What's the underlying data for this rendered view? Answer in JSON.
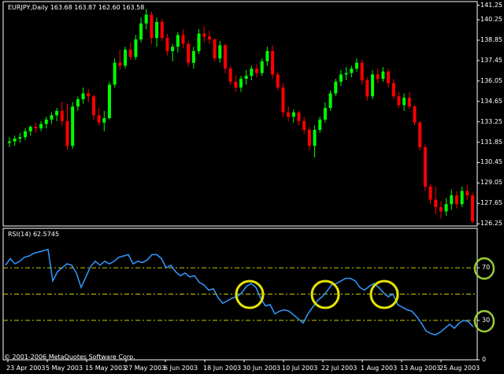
{
  "header": {
    "price_title": "EURJPY,Daily  163.68 163.87 162.60 163.58",
    "rsi_title": "RSI(14) 62.5745",
    "copyright": "© 2001-2006 MetaQuotes Software Corp."
  },
  "colors": {
    "background": "#000000",
    "bull": "#00ff00",
    "bear": "#ff0000",
    "rsi_line": "#3399ff",
    "level_line": "#cccc00",
    "circle_yellow": "#e6e600",
    "circle_green": "#99cc33",
    "axis_text": "#ffffff"
  },
  "chart_data": [
    {
      "type": "candlestick",
      "title": "EURJPY,Daily  163.68 163.87 162.60 163.58",
      "ylim": [
        126.1,
        141.5
      ],
      "y_ticks": [
        "141.25",
        "140.25",
        "138.85",
        "137.45",
        "136.05",
        "134.65",
        "133.25",
        "131.85",
        "130.45",
        "129.05",
        "127.65",
        "126.25"
      ],
      "x_ticks": [
        "23 Apr 2003",
        "5 May 2003",
        "15 May 2003",
        "27 May 2003",
        "6 Jun 2003",
        "18 Jun 2003",
        "30 Jun 2003",
        "10 Jul 2003",
        "22 Jul 2003",
        "1 Aug 2003",
        "13 Aug 2003",
        "25 Aug 2003"
      ],
      "ohlc": [
        [
          131.8,
          132.2,
          131.5,
          131.9
        ],
        [
          131.9,
          132.3,
          131.6,
          132.1
        ],
        [
          132.1,
          132.5,
          131.8,
          132.2
        ],
        [
          132.2,
          132.8,
          132.0,
          132.6
        ],
        [
          132.6,
          133.0,
          132.3,
          132.9
        ],
        [
          132.9,
          133.2,
          132.5,
          132.8
        ],
        [
          132.8,
          133.3,
          132.6,
          133.1
        ],
        [
          133.1,
          133.6,
          132.8,
          133.4
        ],
        [
          133.4,
          133.9,
          133.1,
          133.7
        ],
        [
          133.7,
          134.2,
          133.3,
          134.0
        ],
        [
          134.0,
          134.6,
          133.0,
          133.3
        ],
        [
          133.3,
          134.5,
          131.3,
          131.6
        ],
        [
          131.6,
          134.6,
          131.4,
          134.3
        ],
        [
          134.3,
          135.0,
          134.0,
          134.8
        ],
        [
          134.8,
          135.6,
          134.5,
          135.2
        ],
        [
          135.2,
          135.5,
          134.6,
          135.0
        ],
        [
          135.0,
          135.1,
          133.4,
          133.7
        ],
        [
          133.7,
          134.2,
          133.0,
          133.2
        ],
        [
          133.2,
          134.0,
          132.6,
          133.5
        ],
        [
          133.5,
          136.0,
          133.4,
          135.8
        ],
        [
          135.8,
          137.6,
          135.6,
          137.3
        ],
        [
          137.3,
          138.2,
          136.8,
          137.1
        ],
        [
          137.1,
          138.4,
          136.9,
          138.2
        ],
        [
          138.2,
          138.7,
          137.5,
          137.7
        ],
        [
          137.7,
          139.2,
          137.5,
          138.9
        ],
        [
          138.9,
          140.4,
          138.7,
          140.0
        ],
        [
          140.0,
          141.0,
          139.6,
          140.6
        ],
        [
          140.6,
          140.8,
          138.6,
          139.0
        ],
        [
          139.0,
          140.4,
          138.4,
          140.1
        ],
        [
          140.1,
          140.3,
          138.8,
          139.0
        ],
        [
          139.0,
          139.3,
          137.8,
          138.1
        ],
        [
          138.1,
          138.6,
          137.4,
          138.4
        ],
        [
          138.4,
          139.4,
          138.0,
          139.2
        ],
        [
          139.2,
          139.6,
          138.3,
          138.6
        ],
        [
          138.6,
          138.8,
          137.0,
          137.3
        ],
        [
          137.3,
          138.4,
          136.9,
          138.1
        ],
        [
          138.1,
          139.6,
          137.9,
          139.3
        ],
        [
          139.3,
          139.8,
          138.7,
          139.1
        ],
        [
          139.1,
          139.5,
          138.6,
          138.9
        ],
        [
          138.9,
          139.0,
          137.4,
          137.6
        ],
        [
          137.6,
          138.8,
          137.3,
          138.5
        ],
        [
          138.5,
          138.6,
          136.6,
          136.9
        ],
        [
          136.9,
          137.1,
          135.8,
          136.0
        ],
        [
          136.0,
          136.4,
          135.3,
          135.6
        ],
        [
          135.6,
          136.4,
          135.3,
          136.2
        ],
        [
          136.2,
          136.8,
          135.8,
          136.4
        ],
        [
          136.4,
          137.1,
          136.1,
          136.9
        ],
        [
          136.9,
          137.2,
          136.3,
          136.6
        ],
        [
          136.6,
          137.6,
          136.4,
          137.4
        ],
        [
          137.4,
          138.4,
          137.1,
          138.1
        ],
        [
          138.1,
          138.5,
          136.2,
          136.5
        ],
        [
          136.5,
          136.7,
          135.4,
          135.6
        ],
        [
          135.6,
          135.9,
          133.6,
          133.9
        ],
        [
          133.9,
          134.3,
          133.3,
          133.6
        ],
        [
          133.6,
          134.1,
          133.2,
          133.9
        ],
        [
          133.9,
          134.0,
          133.0,
          133.3
        ],
        [
          133.3,
          133.6,
          132.4,
          132.7
        ],
        [
          132.7,
          132.9,
          131.3,
          131.6
        ],
        [
          131.6,
          133.0,
          130.8,
          132.7
        ],
        [
          132.7,
          133.6,
          132.5,
          133.4
        ],
        [
          133.4,
          134.6,
          133.2,
          134.2
        ],
        [
          134.2,
          135.4,
          134.0,
          135.2
        ],
        [
          135.2,
          136.2,
          135.0,
          136.0
        ],
        [
          136.0,
          136.8,
          135.7,
          136.5
        ],
        [
          136.5,
          137.0,
          136.1,
          136.6
        ],
        [
          136.6,
          137.1,
          136.3,
          136.9
        ],
        [
          136.9,
          137.6,
          136.7,
          137.3
        ],
        [
          137.3,
          137.5,
          135.8,
          136.1
        ],
        [
          136.1,
          136.3,
          134.7,
          135.0
        ],
        [
          135.0,
          136.8,
          134.8,
          136.5
        ],
        [
          136.5,
          136.9,
          135.9,
          136.2
        ],
        [
          136.2,
          137.0,
          136.0,
          136.7
        ],
        [
          136.7,
          136.9,
          135.6,
          135.9
        ],
        [
          135.9,
          136.2,
          134.8,
          135.0
        ],
        [
          135.0,
          135.3,
          134.2,
          134.4
        ],
        [
          134.4,
          135.2,
          134.0,
          134.9
        ],
        [
          134.9,
          135.3,
          134.1,
          134.3
        ],
        [
          134.3,
          134.4,
          133.0,
          133.2
        ],
        [
          133.2,
          133.3,
          131.3,
          131.5
        ],
        [
          131.5,
          131.7,
          128.5,
          128.8
        ],
        [
          128.8,
          129.0,
          127.6,
          127.9
        ],
        [
          127.9,
          128.8,
          126.9,
          127.4
        ],
        [
          127.4,
          127.8,
          126.6,
          127.1
        ],
        [
          127.1,
          128.0,
          126.8,
          127.6
        ],
        [
          127.6,
          128.6,
          127.2,
          128.2
        ],
        [
          128.2,
          128.5,
          127.3,
          127.6
        ],
        [
          127.6,
          128.8,
          127.4,
          128.5
        ],
        [
          128.5,
          128.9,
          127.9,
          128.2
        ],
        [
          128.2,
          128.4,
          126.3,
          126.4
        ]
      ]
    },
    {
      "type": "line",
      "title": "RSI(14) 62.5745",
      "ylim": [
        0,
        100
      ],
      "y_ticks": [
        "70",
        "30",
        "0"
      ],
      "levels": [
        70,
        50,
        30
      ],
      "x": [
        7,
        13,
        19,
        25,
        31,
        37,
        43,
        49,
        55,
        61,
        67,
        73,
        79,
        85,
        91,
        97,
        103,
        109,
        115,
        121,
        127,
        133,
        139,
        145,
        151,
        157,
        163,
        169,
        175,
        181,
        187,
        193,
        199,
        205,
        211,
        217,
        223,
        229,
        235,
        241,
        247,
        253,
        259,
        265,
        271,
        277,
        283,
        289,
        295,
        301,
        307,
        313,
        319,
        325,
        331,
        337,
        343,
        349,
        355,
        361,
        367,
        373,
        379,
        385,
        391,
        397,
        403,
        409,
        415,
        421,
        427,
        433,
        439,
        445,
        451,
        457,
        463,
        469,
        475,
        481,
        487,
        493,
        499,
        505,
        511,
        517,
        523,
        529,
        535,
        541,
        547,
        553,
        559,
        565,
        571,
        577,
        583,
        589,
        595,
        601
      ],
      "values": [
        72,
        77,
        73,
        75,
        78,
        79,
        81,
        82,
        83,
        84,
        60,
        67,
        70,
        73,
        72,
        66,
        55,
        63,
        71,
        75,
        72,
        75,
        73,
        75,
        78,
        79,
        80,
        73,
        75,
        74,
        76,
        80,
        80,
        77,
        70,
        72,
        67,
        64,
        66,
        63,
        64,
        59,
        57,
        53,
        54,
        47,
        43,
        45,
        47,
        48,
        51,
        56,
        58,
        55,
        47,
        41,
        42,
        35,
        37,
        38,
        37,
        34,
        31,
        28,
        35,
        40,
        45,
        48,
        52,
        57,
        58,
        60,
        62,
        62,
        60,
        55,
        53,
        56,
        58,
        55,
        51,
        48,
        50,
        42,
        40,
        38,
        37,
        33,
        28,
        22,
        20,
        19,
        21,
        24,
        27,
        24,
        28,
        30,
        29,
        25
      ]
    }
  ]
}
